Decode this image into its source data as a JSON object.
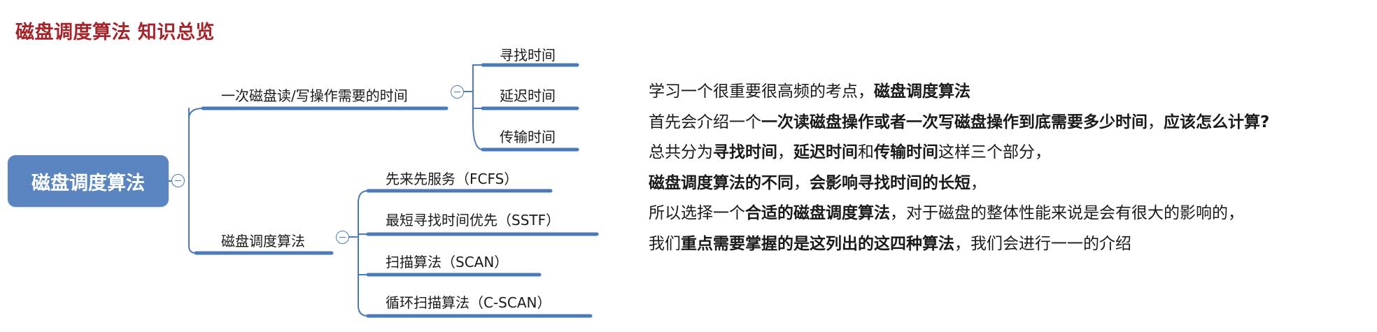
{
  "title": "磁盘调度算法 知识总览",
  "colors": {
    "title": "#a5252b",
    "root_fill": "#5b85c0",
    "branch_line": "#4a7ab8",
    "text": "#1a1a1a"
  },
  "mindmap": {
    "root": "磁盘调度算法",
    "branches": [
      {
        "label": "一次磁盘读/写操作需要的时间",
        "children": [
          "寻找时间",
          "延迟时间",
          "传输时间"
        ]
      },
      {
        "label": "磁盘调度算法",
        "children": [
          "先来先服务（FCFS）",
          "最短寻找时间优先（SSTF）",
          "扫描算法（SCAN）",
          "循环扫描算法（C-SCAN）"
        ]
      }
    ]
  },
  "description": {
    "lines": [
      [
        {
          "t": "学习一个很重要很高频的考点，",
          "b": false
        },
        {
          "t": "磁盘调度算法",
          "b": true
        }
      ],
      [
        {
          "t": "首先会介绍一个",
          "b": false
        },
        {
          "t": "一次读磁盘操作或者一次写磁盘操作到底需要多少时间",
          "b": true
        },
        {
          "t": "，",
          "b": false
        },
        {
          "t": "应该怎么计算?",
          "b": true
        }
      ],
      [
        {
          "t": "总共分为",
          "b": false
        },
        {
          "t": "寻找时间",
          "b": true
        },
        {
          "t": "，",
          "b": false
        },
        {
          "t": "延迟时间",
          "b": true
        },
        {
          "t": "和",
          "b": false
        },
        {
          "t": "传输时间",
          "b": true
        },
        {
          "t": "这样三个部分，",
          "b": false
        }
      ],
      [
        {
          "t": "磁盘调度算法的不同",
          "b": true
        },
        {
          "t": "，",
          "b": false
        },
        {
          "t": "会影响寻找时间的长短",
          "b": true
        },
        {
          "t": "，",
          "b": false
        }
      ],
      [
        {
          "t": "所以选择一个",
          "b": false
        },
        {
          "t": "合适的磁盘调度算法",
          "b": true
        },
        {
          "t": "，对于磁盘的整体性能来说是会有很大的影响的，",
          "b": false
        }
      ],
      [
        {
          "t": "我们",
          "b": false
        },
        {
          "t": "重点需要掌握的是这列出的这四种算法",
          "b": true
        },
        {
          "t": "，我们会进行一一的介绍",
          "b": false
        }
      ]
    ]
  }
}
